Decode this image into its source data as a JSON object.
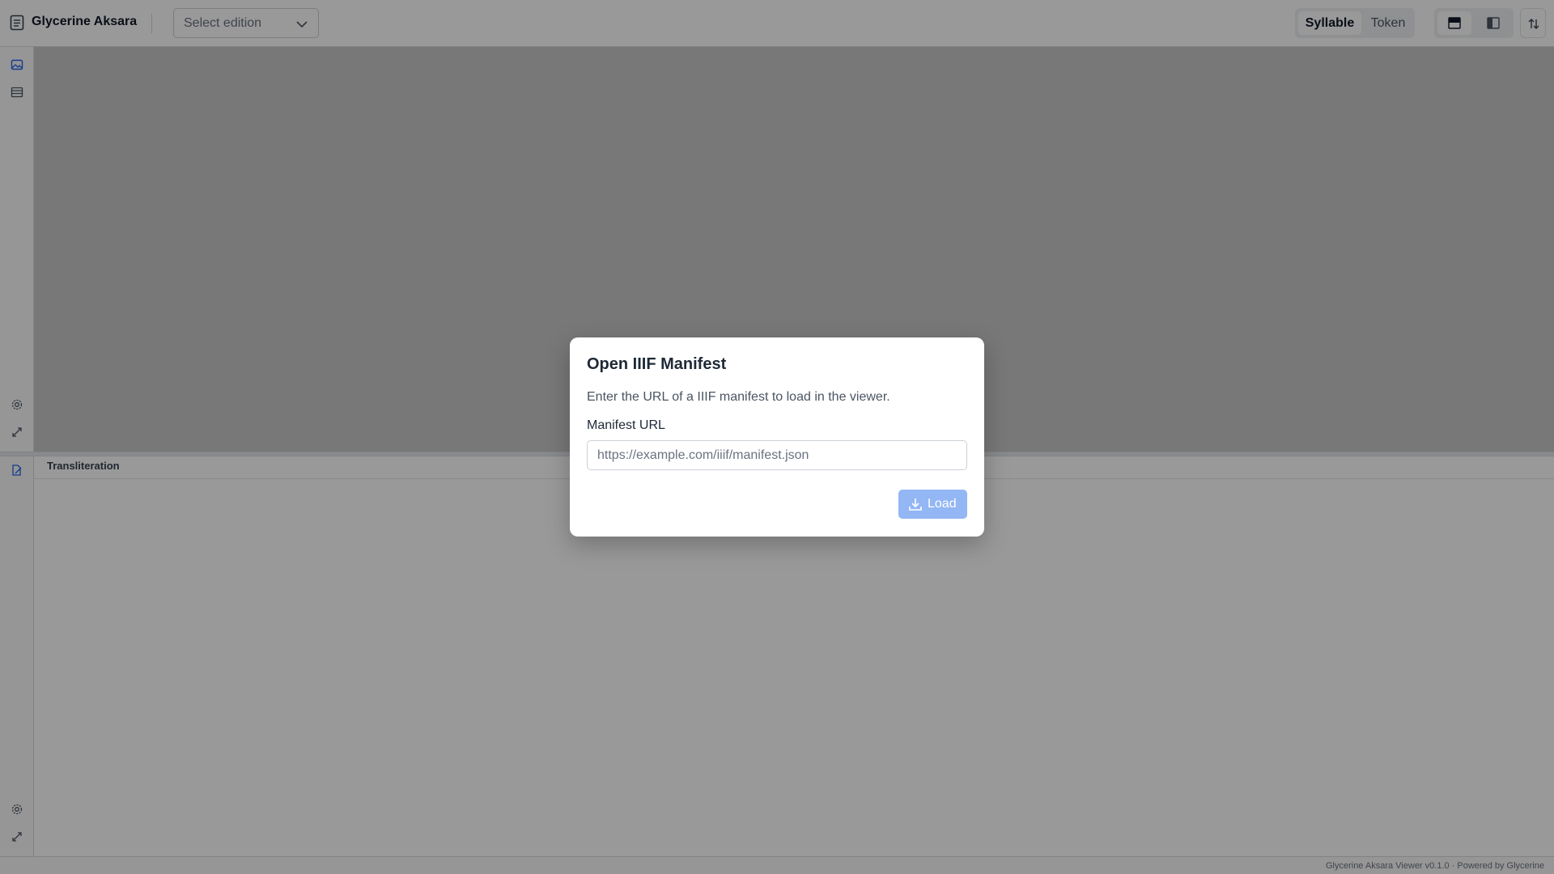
{
  "header": {
    "app_title": "Glycerine Aksara",
    "app_icon": "document-icon",
    "edition_select": {
      "value": "Select edition",
      "icon": "chevron-down-icon"
    },
    "mode_toggle": {
      "options": [
        "Syllable",
        "Token"
      ],
      "selected": "Syllable"
    },
    "layout_buttons": [
      "stacked-layout-icon",
      "split-layout-icon"
    ],
    "swap_button_icon": "swap-vertical-icon"
  },
  "rail": {
    "top_icons": [
      "image-icon",
      "list-icon"
    ],
    "viewer_icons": [
      "gear-icon",
      "expand-icon"
    ],
    "translit_icons": [
      "edit-icon"
    ],
    "bottom_icons": [
      "gear-icon",
      "expand-icon"
    ]
  },
  "transliteration_panel": {
    "title": "Transliteration"
  },
  "status_bar": {
    "text": "Glycerine Aksara Viewer v0.1.0 · Powered by Glycerine"
  },
  "dialog": {
    "title": "Open IIIF Manifest",
    "description": "Enter the URL of a IIIF manifest to load in the viewer.",
    "field_label": "Manifest URL",
    "field_placeholder": "https://example.com/iiif/manifest.json",
    "field_value": "",
    "load_label": "Load",
    "load_icon": "download-icon"
  },
  "colors": {
    "accent": "#93b6f5",
    "rail_active": "#2563eb",
    "overlay": "rgba(0,0,0,0.4)"
  }
}
